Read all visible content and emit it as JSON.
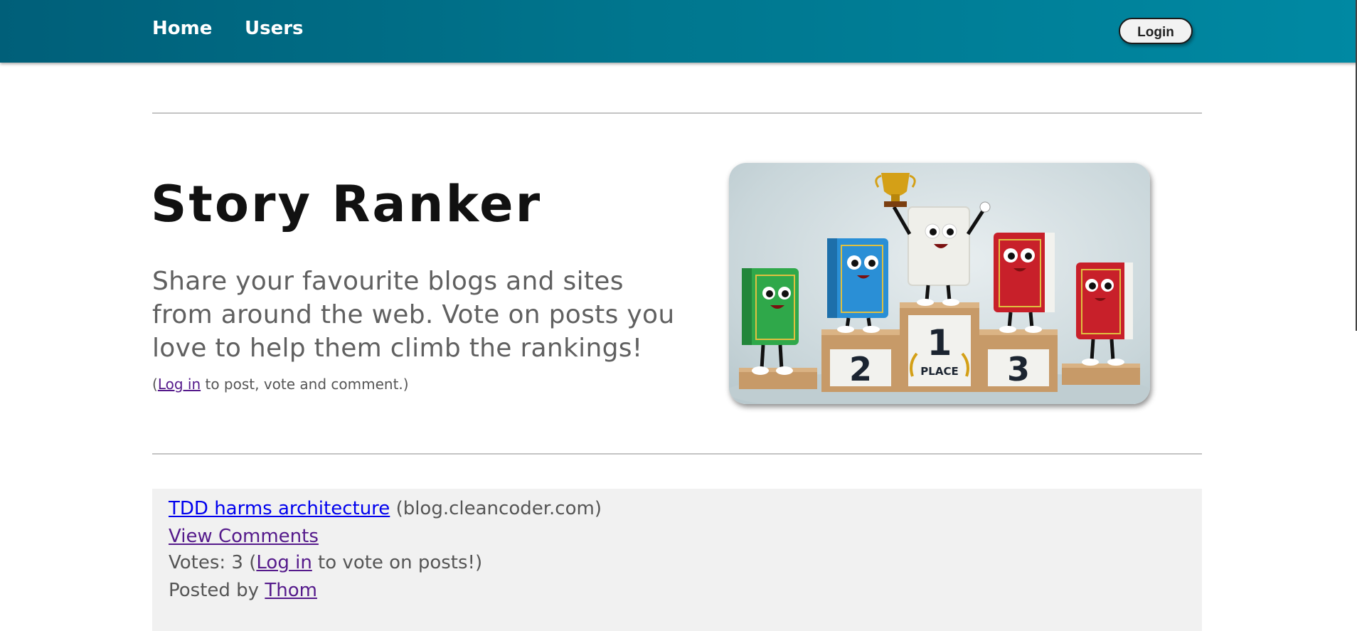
{
  "nav": {
    "home_label": "Home",
    "users_label": "Users",
    "login_label": "Login"
  },
  "hero": {
    "title": "Story Ranker",
    "subtitle": "Share your favourite blogs and sites from around the web. Vote on posts you love to help them climb the rankings!",
    "note_prefix": "(",
    "note_link": "Log in",
    "note_suffix": " to post, vote and comment.)",
    "image": {
      "podium_labels": [
        "1",
        "PLACE",
        "2",
        "3"
      ],
      "colors": {
        "green_book": "#2fa84a",
        "blue_book": "#2a8fd6",
        "white_book": "#efefea",
        "red_book": "#c8202a",
        "podium": "#c79a68",
        "trophy": "#d4a017"
      }
    }
  },
  "posts": [
    {
      "title": "TDD harms architecture",
      "domain": "(blog.cleancoder.com)",
      "comments_label": "View Comments",
      "votes_prefix": "Votes: 3 (",
      "votes_link": "Log in",
      "votes_suffix": " to vote on posts!)",
      "posted_by_prefix": "Posted by ",
      "author": "Thom"
    }
  ]
}
